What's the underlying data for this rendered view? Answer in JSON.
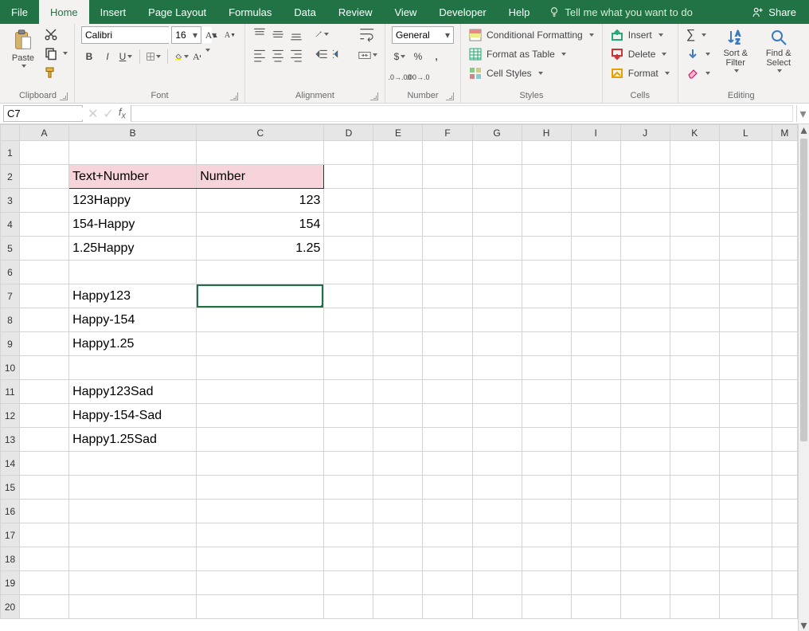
{
  "tabs": {
    "file": "File",
    "home": "Home",
    "insert": "Insert",
    "pagelayout": "Page Layout",
    "formulas": "Formulas",
    "data": "Data",
    "review": "Review",
    "view": "View",
    "developer": "Developer",
    "help": "Help",
    "tellme": "Tell me what you want to do",
    "share": "Share"
  },
  "ribbon": {
    "clipboard": {
      "paste": "Paste",
      "label": "Clipboard"
    },
    "font": {
      "name": "Calibri",
      "size": "16",
      "label": "Font"
    },
    "alignment": {
      "label": "Alignment"
    },
    "number": {
      "format": "General",
      "label": "Number"
    },
    "styles": {
      "cond": "Conditional Formatting",
      "table": "Format as Table",
      "cell": "Cell Styles",
      "label": "Styles"
    },
    "cells": {
      "insert": "Insert",
      "delete": "Delete",
      "format": "Format",
      "label": "Cells"
    },
    "editing": {
      "sort": "Sort & Filter",
      "find": "Find & Select",
      "label": "Editing"
    }
  },
  "formulabar": {
    "namebox": "C7",
    "formula": ""
  },
  "columns": [
    "A",
    "B",
    "C",
    "D",
    "E",
    "F",
    "G",
    "H",
    "I",
    "J",
    "K",
    "L",
    "M"
  ],
  "rows": 20,
  "active_col": "C",
  "active_row": 7,
  "header_range": {
    "from": "B2",
    "to": "C2"
  },
  "cells": {
    "B2": {
      "v": "Text+Number",
      "cls": "hdr"
    },
    "C2": {
      "v": "Number",
      "cls": "hdr"
    },
    "B3": {
      "v": "123Happy"
    },
    "C3": {
      "v": "123",
      "cls": "num"
    },
    "B4": {
      "v": "154-Happy"
    },
    "C4": {
      "v": "154",
      "cls": "num"
    },
    "B5": {
      "v": "1.25Happy"
    },
    "C5": {
      "v": "1.25",
      "cls": "num"
    },
    "B7": {
      "v": "Happy123"
    },
    "B8": {
      "v": "Happy-154"
    },
    "B9": {
      "v": "Happy1.25"
    },
    "B11": {
      "v": "Happy123Sad"
    },
    "B12": {
      "v": "Happy-154-Sad"
    },
    "B13": {
      "v": "Happy1.25Sad"
    }
  }
}
